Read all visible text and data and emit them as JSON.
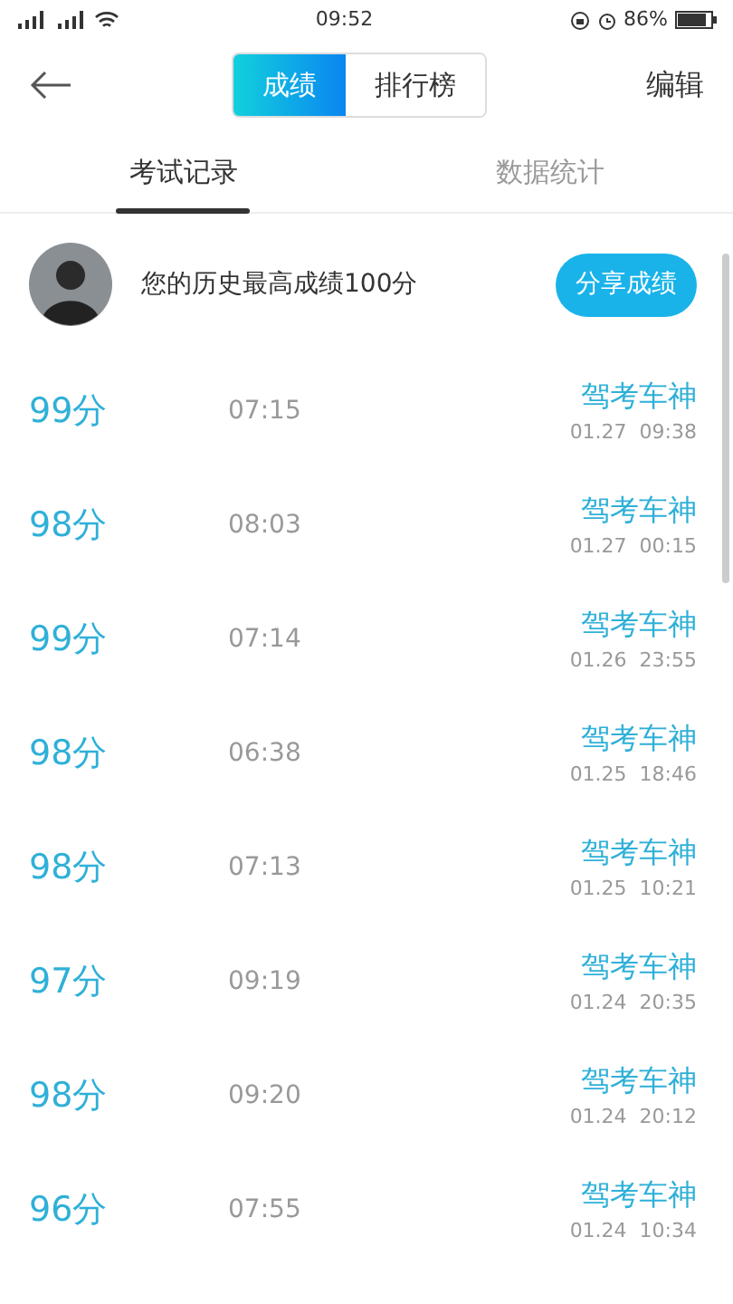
{
  "status_bar": {
    "time": "09:52",
    "battery_text": "86%"
  },
  "header": {
    "segments": [
      {
        "label": "成绩",
        "selected": true
      },
      {
        "label": "排行榜",
        "selected": false
      }
    ],
    "action": "编辑"
  },
  "tabs": [
    {
      "label": "考试记录",
      "selected": true
    },
    {
      "label": "数据统计",
      "selected": false
    }
  ],
  "summary": {
    "text": "您的历史最高成绩100分",
    "button": "分享成绩"
  },
  "records": [
    {
      "score": "99分",
      "duration": "07:15",
      "title": "驾考车神",
      "date": "01.27  09:38"
    },
    {
      "score": "98分",
      "duration": "08:03",
      "title": "驾考车神",
      "date": "01.27  00:15"
    },
    {
      "score": "99分",
      "duration": "07:14",
      "title": "驾考车神",
      "date": "01.26  23:55"
    },
    {
      "score": "98分",
      "duration": "06:38",
      "title": "驾考车神",
      "date": "01.25  18:46"
    },
    {
      "score": "98分",
      "duration": "07:13",
      "title": "驾考车神",
      "date": "01.25  10:21"
    },
    {
      "score": "97分",
      "duration": "09:19",
      "title": "驾考车神",
      "date": "01.24  20:35"
    },
    {
      "score": "98分",
      "duration": "09:20",
      "title": "驾考车神",
      "date": "01.24  20:12"
    },
    {
      "score": "96分",
      "duration": "07:55",
      "title": "驾考车神",
      "date": "01.24  10:34"
    }
  ]
}
